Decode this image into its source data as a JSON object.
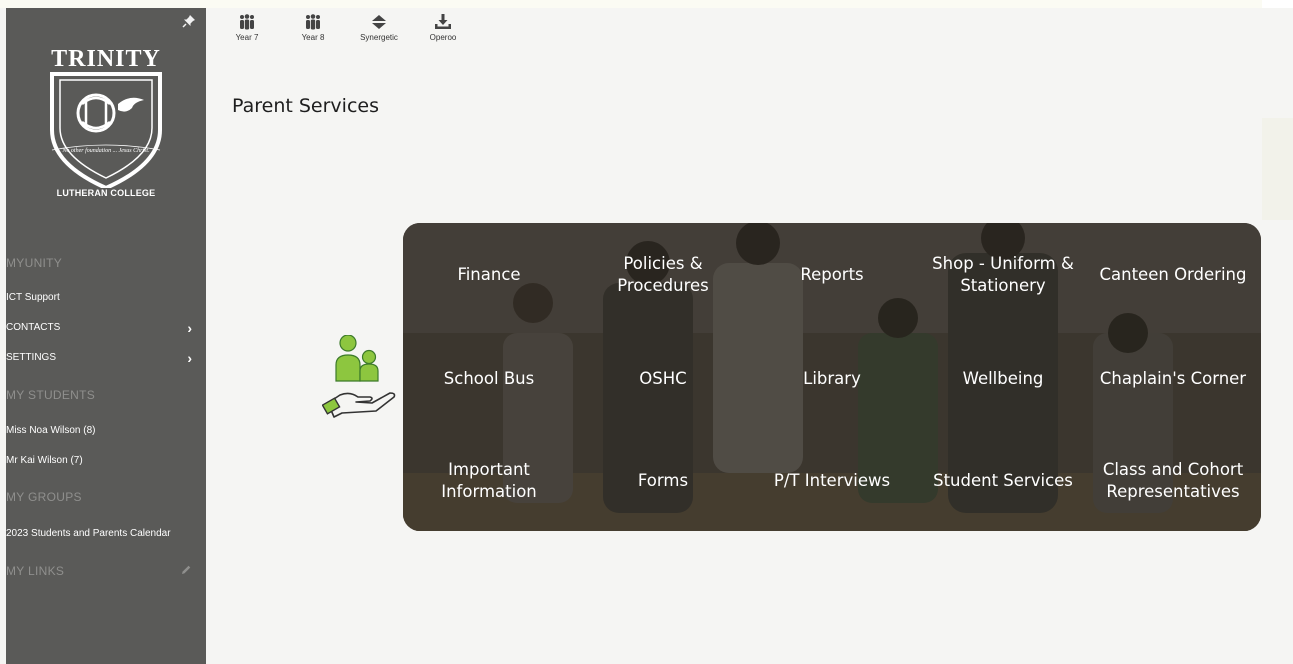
{
  "sidebar": {
    "logo": {
      "brand_text": "TRINITY",
      "motto": "No other foundation ... Jesus Christ.",
      "college": "LUTHERAN COLLEGE"
    },
    "sections": {
      "myunity": "MYUNITY",
      "my_students": "MY STUDENTS",
      "my_groups": "MY GROUPS",
      "my_links": "MY LINKS"
    },
    "items": {
      "ict_support": "ICT Support",
      "contacts": "CONTACTS",
      "settings": "SETTINGS",
      "student_1": "Miss Noa Wilson (8)",
      "student_2": "Mr Kai Wilson (7)",
      "group_1": "2023 Students and Parents Calendar"
    },
    "icons": [
      "pin-icon",
      "chevron-right-icon",
      "pencil-icon"
    ]
  },
  "toolbar": {
    "items": [
      {
        "label": "Year 7",
        "icon": "group-icon"
      },
      {
        "label": "Year 8",
        "icon": "group-icon"
      },
      {
        "label": "Synergetic",
        "icon": "synergetic-icon"
      },
      {
        "label": "Operoo",
        "icon": "download-icon"
      }
    ]
  },
  "page": {
    "title": "Parent Services"
  },
  "services": {
    "tiles": [
      "Finance",
      "Policies & Procedures",
      "Reports",
      "Shop - Uniform & Stationery",
      "Canteen Ordering",
      "School Bus",
      "OSHC",
      "Library",
      "Wellbeing",
      "Chaplain's Corner",
      "Important Information",
      "Forms",
      "P/T Interviews",
      "Student Services",
      "Class and Cohort Representatives"
    ]
  },
  "colors": {
    "sidebar": "#5a5a58",
    "accent_green": "#8dc63f",
    "panel_dark": "#463f37",
    "content_bg": "#f5f5f3"
  }
}
